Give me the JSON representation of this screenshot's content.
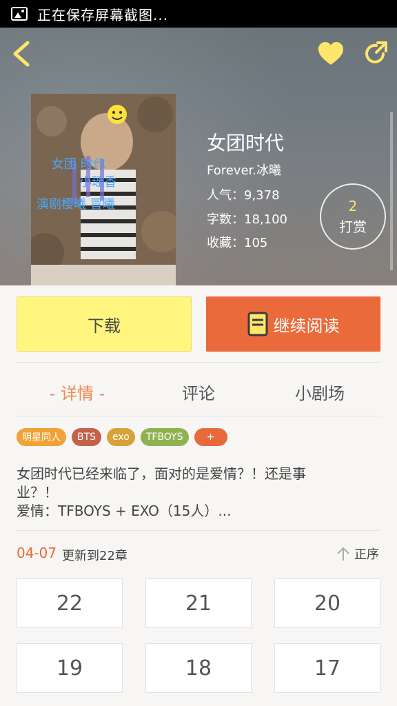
{
  "status_bar": {
    "text": "正在保存屏幕截图..."
  },
  "book": {
    "title": "女团时代",
    "author": "Forever.冰曦",
    "popularity": "人气：9,378",
    "word_count": "字数：18,100",
    "favorites": "收藏：105"
  },
  "cover": {
    "lines": [
      "女团 时代",
      "小瑶香",
      "演剧樱曦 冒曦"
    ]
  },
  "tip": {
    "count": "2",
    "label": "打赏"
  },
  "actions": {
    "download_label": "下载",
    "continue_label": "继续阅读"
  },
  "tabs": [
    {
      "label": "- 详情 -",
      "active": true
    },
    {
      "label": "评论",
      "active": false
    },
    {
      "label": "小剧场",
      "active": false
    }
  ],
  "tags": [
    {
      "label": "明星同人",
      "color": "#f0a236"
    },
    {
      "label": "BTS",
      "color": "#c5614a"
    },
    {
      "label": "exo",
      "color": "#d8a13a"
    },
    {
      "label": "TFBOYS",
      "color": "#8fb24f"
    },
    {
      "label": "+",
      "color": "#e8693a"
    }
  ],
  "description": {
    "line1": "女团时代已经来临了，面对的是爱情？！还是事",
    "line2": "业？！",
    "line3": "爱情：TFBOYS + EXO（15人）..."
  },
  "update": {
    "date": "04-07",
    "text": "更新到22章",
    "sort_label": "正序"
  },
  "chapters": [
    "22",
    "21",
    "20",
    "19",
    "18",
    "17"
  ],
  "colors": {
    "accent": "#e8693a",
    "download": "#fff57f",
    "heart": "#ffe66b"
  }
}
